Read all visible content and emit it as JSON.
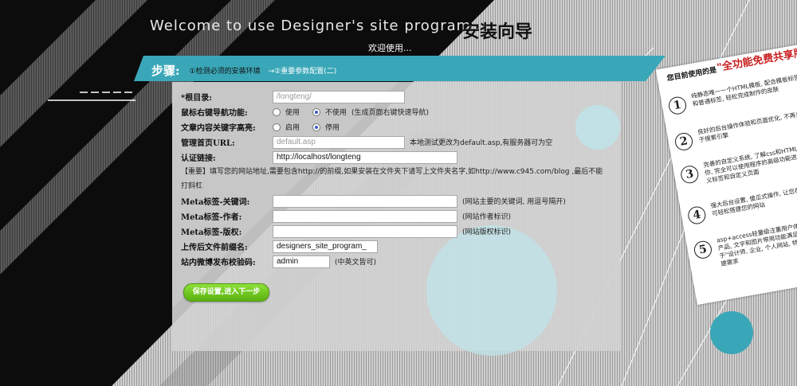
{
  "header": {
    "title_en": "Welcome to use Designer's site program",
    "title_cn": "安装向导",
    "welcome": "欢迎使用..."
  },
  "steps": {
    "label": "步骤:",
    "step1": "①检测必须的安装环境",
    "step2": "→②重要参数配置(二)"
  },
  "form": {
    "root_dir": {
      "label": "*根目录:",
      "placeholder": "/longteng/"
    },
    "nav_func": {
      "label": "鼠标右键导航功能:",
      "opt_use": "使用",
      "opt_nouse": "不使用",
      "hint": "(生成页面右键快速导航)",
      "selected": "不使用"
    },
    "keyword_hl": {
      "label": "文章内容关键字高亮:",
      "opt_on": "启用",
      "opt_off": "停用",
      "selected": "停用"
    },
    "home_url": {
      "label": "管理首页URL:",
      "placeholder": "default.asp",
      "hint": "本地测试更改为default.asp,有服务器可为空"
    },
    "auth_link": {
      "label": "认证链接:",
      "value": "http://localhost/longteng"
    },
    "note": "【重要】填写您的网站地址,需要包含http://的前缀,如果安装在文件夹下请写上文件夹名字,如http://www.c945.com/blog ,最后不能打斜杠",
    "meta_keywords": {
      "label": "Meta标签-关键词:",
      "value": "",
      "hint": "(网站主要的关键词, 用逗号隔开)"
    },
    "meta_author": {
      "label": "Meta标签-作者:",
      "value": "",
      "hint": "(网站作者标识)"
    },
    "meta_copyright": {
      "label": "Meta标签-版权:",
      "value": "",
      "hint": "(网站版权标识)"
    },
    "file_prefix": {
      "label": "上传后文件前缀名:",
      "value": "designers_site_program_"
    },
    "weibo_code": {
      "label": "站内微博发布校验码:",
      "value": "admin",
      "hint": "(中英文皆可)"
    },
    "save_button": "保存设置,进入下一步"
  },
  "promo": {
    "head1": "您目前使用的是",
    "head2": "\"全功能免费共享版\"",
    "items": [
      {
        "num": "1",
        "text": "纯静态唯一一个HTML模板, 配合模板标签和普通标签, 轻松完成制作的皮肤"
      },
      {
        "num": "2",
        "text": "良好的后台操作体验和页面优化, 不再头疼于搜索引擎"
      },
      {
        "num": "3",
        "text": "完善的自定义系统, 了解css和HTML代码的你, 完全可以使用程序的高级功能进行自定义标签和自定义页面"
      },
      {
        "num": "4",
        "text": "强大后台设置, 傻瓜式操作, 让您在3分钟即可轻松搭建您的网站"
      },
      {
        "num": "5",
        "text": "asp+access轻量级注重用户体验和SEO的产品, 文字和图片带用功能满足轻松完成属于\"设计师, 企业, 个人网站, 特色网站\"的搭建需求"
      }
    ]
  },
  "colors": {
    "accent_teal": "#3aa7b8",
    "button_green": "#6cc51e",
    "panel_bg": "#d2d2d2",
    "promo_red": "#c82020"
  }
}
